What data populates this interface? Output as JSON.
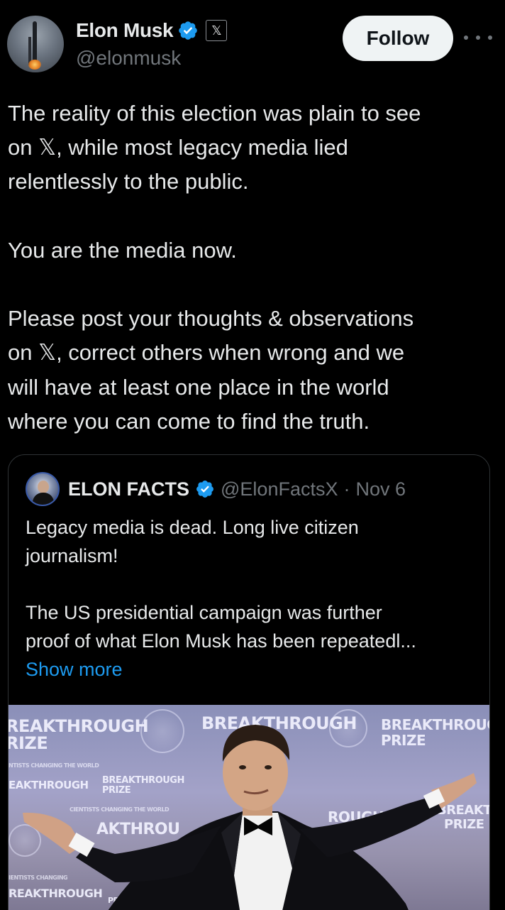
{
  "author": {
    "name": "Elon Musk",
    "handle": "@elonmusk",
    "affiliate_badge": "𝕏"
  },
  "follow_button": "Follow",
  "tweet": {
    "paragraphs": [
      "The reality of this election was plain to see\non 𝕏, while most legacy media lied\nrelentlessly to the public.",
      "You are the media now.",
      "Please post your thoughts & observations\non 𝕏, correct others when wrong and we\nwill have at least one place in the world\nwhere you can come to find the truth."
    ]
  },
  "quoted_post": {
    "name": "ELON FACTS",
    "handle": "@ElonFactsX",
    "separator": "·",
    "date": "Nov 6",
    "paragraphs": [
      "Legacy media is dead. Long live citizen\njournalism!",
      "The US presidential campaign was further\nproof of what Elon Musk has been repeatedl..."
    ],
    "show_more": "Show more",
    "photo_backdrop_text": {
      "big1": "REAKTHROUGH",
      "big1b": "RIZE",
      "big2": "BREAKTHROUGH",
      "big3": "BREAKTHROUGH",
      "big3b": "PRIZE",
      "tag1": "NTISTS CHANGING THE WORLD",
      "mid1": "EAKTHROUGH",
      "mid2": "BREAKTHROUGH",
      "mid2b": "PRIZE",
      "mid3": "AKTHROU",
      "mid4": "ROUGH",
      "mid5": "BREAKTHR",
      "mid5b": "PRIZE",
      "tag2": "IENTISTS CHANGING",
      "mid6": "REAKTHROUGH",
      "mid7": "PRIZE",
      "mid8": "CIENTISTS CHANGING THE WORLD"
    }
  },
  "colors": {
    "background": "#000000",
    "text": "#e7e9ea",
    "secondary": "#71767b",
    "link": "#1d9bf0",
    "verified": "#1d9bf0",
    "border": "#2f3336",
    "follow_bg": "#eff3f4"
  },
  "icons": {
    "verified": "verified-badge-icon",
    "affiliate": "x-logo-icon",
    "more": "more-horizontal-icon"
  }
}
